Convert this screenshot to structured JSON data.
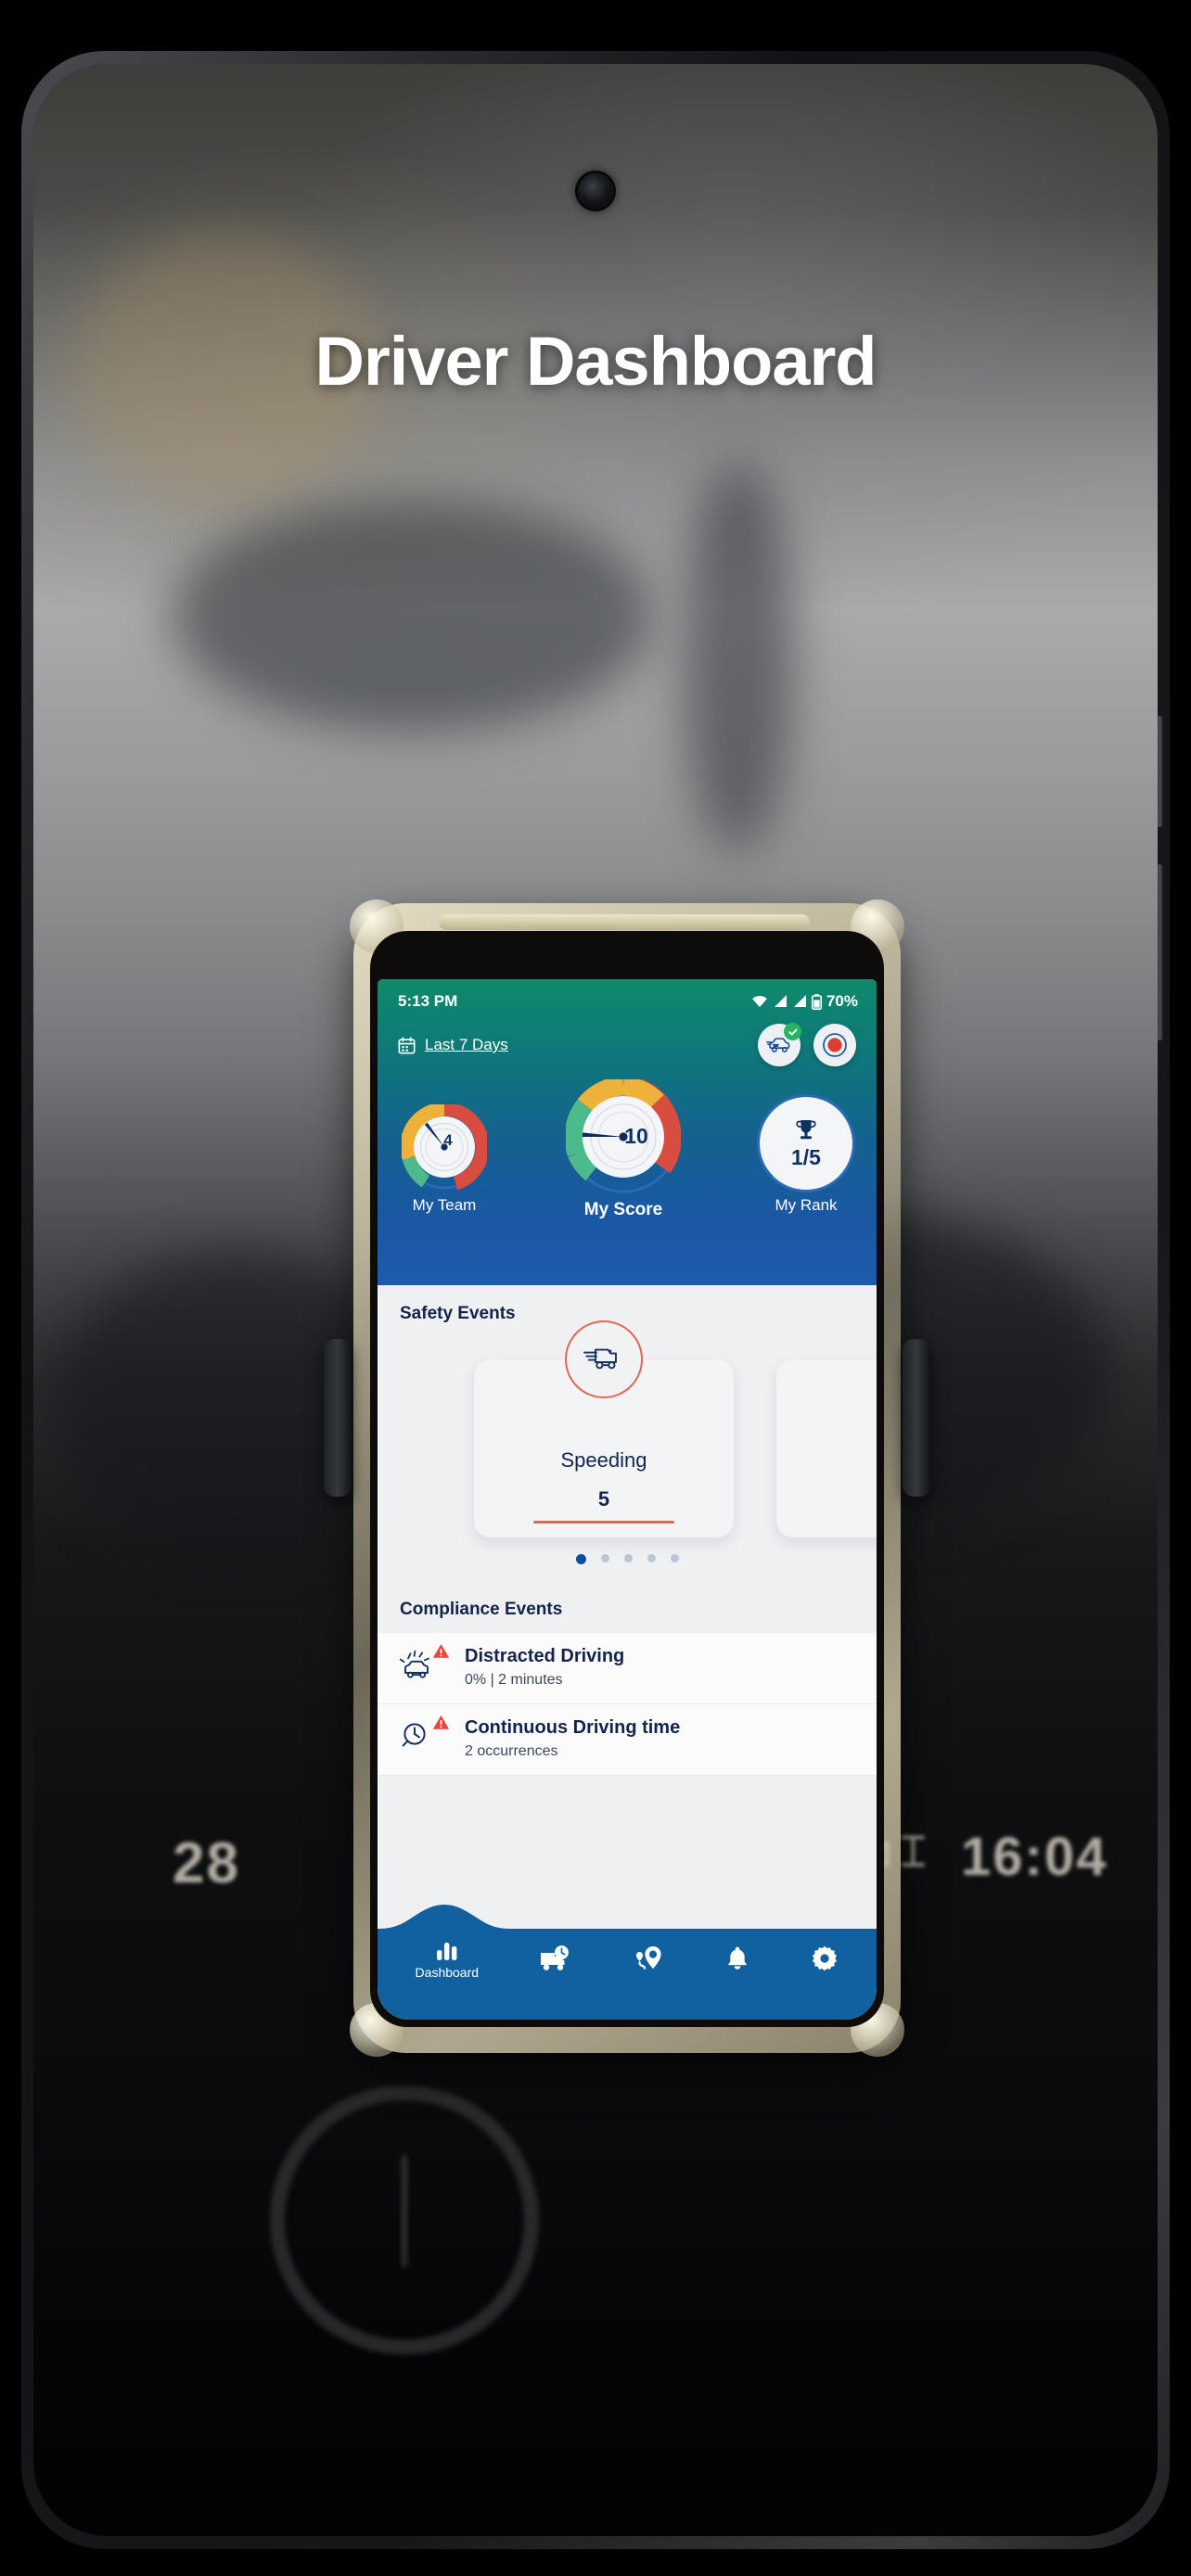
{
  "page": {
    "title": "Driver Dashboard"
  },
  "phone": {
    "statusbar": {
      "time": "5:13 PM",
      "battery": "70%",
      "icons": [
        "wifi-icon",
        "signal-icon",
        "signal-icon",
        "battery-icon"
      ]
    },
    "header": {
      "period_label": "Last 7 Days",
      "calendar_icon": "calendar-icon",
      "actions": [
        {
          "name": "vehicle-status-button",
          "icon": "car-check-icon"
        },
        {
          "name": "record-button",
          "icon": "record-dot-icon"
        }
      ],
      "gauges": [
        {
          "label": "My Team",
          "value": "4",
          "primary": false
        },
        {
          "label": "My Score",
          "value": "10",
          "primary": true
        },
        {
          "label": "My Rank",
          "value": "1/5",
          "icon": "trophy-icon",
          "primary": false
        }
      ]
    },
    "safety": {
      "section_title": "Safety Events",
      "cards": [
        {
          "name": "Speeding",
          "count": "5",
          "icon": "speeding-truck-icon"
        },
        {
          "name": "",
          "count": "",
          "icon": ""
        }
      ],
      "dots_total": 5,
      "dots_active_index": 0
    },
    "compliance": {
      "section_title": "Compliance Events",
      "items": [
        {
          "title": "Distracted Driving",
          "subtitle": "0% | 2 minutes",
          "icon": "distracted-driving-icon",
          "alert": "warning-triangle-icon"
        },
        {
          "title": "Continuous Driving time",
          "subtitle": "2 occurrences",
          "icon": "clock-icon",
          "alert": "warning-triangle-icon"
        }
      ]
    },
    "bottom_nav": [
      {
        "label": "Dashboard",
        "icon": "bar-chart-icon",
        "active": true
      },
      {
        "label": "",
        "icon": "truck-clock-icon",
        "active": false
      },
      {
        "label": "",
        "icon": "route-pin-icon",
        "active": false
      },
      {
        "label": "",
        "icon": "bell-icon",
        "active": false
      },
      {
        "label": "",
        "icon": "gear-icon",
        "active": false
      }
    ]
  },
  "colors": {
    "header_top": "#0f8a6b",
    "header_bottom": "#1d5bad",
    "nav_blue": "#11609f",
    "accent_orange": "#e2674f",
    "navy_text": "#13234a",
    "gauge_green": "#4cba8b",
    "gauge_amber": "#eeb23a",
    "gauge_red": "#d94c40",
    "dot_active": "#0b4f9e"
  }
}
